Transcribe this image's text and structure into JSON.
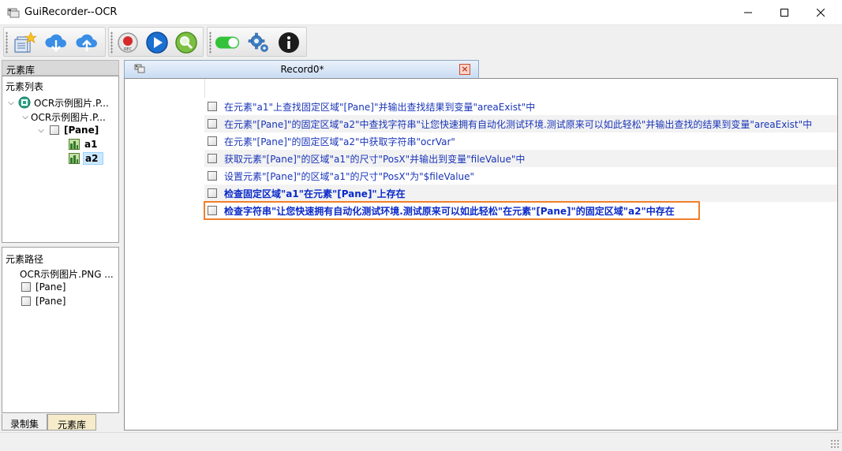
{
  "window": {
    "title": "GuiRecorder--OCR",
    "minimize_glyph": "—",
    "maximize_glyph": "☐",
    "close_glyph": "✕"
  },
  "toolbar": {
    "groups": [
      {
        "buttons": [
          "new-file-icon",
          "download-cloud-icon",
          "upload-cloud-icon"
        ]
      },
      {
        "buttons": [
          "record-icon",
          "play-icon",
          "search-icon"
        ]
      },
      {
        "buttons": [
          "toggle-on-icon",
          "settings-gear-icon",
          "info-icon"
        ]
      }
    ],
    "record_label": "REC"
  },
  "left_panel": {
    "library_header": "元素库",
    "tree_title": "元素列表",
    "tree": [
      {
        "label": "OCR示例图片.P...",
        "level": 0,
        "expanded": true,
        "icon": "target-icon"
      },
      {
        "label": "OCR示例图片.P...",
        "level": 1,
        "expanded": true,
        "icon": "none"
      },
      {
        "label": "[Pane]",
        "level": 2,
        "expanded": true,
        "icon": "checkbox-icon"
      },
      {
        "label": "a1",
        "level": 3,
        "icon": "image-element-icon"
      },
      {
        "label": "a2",
        "level": 3,
        "icon": "image-element-icon",
        "selected": true
      }
    ],
    "path_title": "元素路径",
    "path_items": [
      "OCR示例图片.PNG ...",
      "[Pane]",
      "[Pane]"
    ],
    "bottom_tabs": [
      "录制集",
      "元素库"
    ],
    "active_bottom_tab": "元素库"
  },
  "document": {
    "tab_title": "Record0*",
    "tab_close_glyph": "×",
    "steps": [
      {
        "text": "在元素\"a1\"上查找固定区域\"[Pane]\"并输出查找结果到变量\"areaExist\"中",
        "bold": false
      },
      {
        "text": "在元素\"[Pane]\"的固定区域\"a2\"中查找字符串\"让您快速拥有自动化测试环境.测试原来可以如此轻松\"并输出查找的结果到变量\"areaExist\"中",
        "bold": false
      },
      {
        "text": "在元素\"[Pane]\"的固定区域\"a2\"中获取字符串\"ocrVar\"",
        "bold": false
      },
      {
        "text": "获取元素\"[Pane]\"的区域\"a1\"的尺寸\"PosX\"并输出到变量\"fileValue\"中",
        "bold": false
      },
      {
        "text": "设置元素\"[Pane]\"的区域\"a1\"的尺寸\"PosX\"为\"$fileValue\"",
        "bold": false
      },
      {
        "text": "检查固定区域\"a1\"在元素\"[Pane]\"上存在",
        "bold": true
      },
      {
        "text": "检查字符串\"让您快速拥有自动化测试环境.测试原来可以如此轻松\"在元素\"[Pane]\"的固定区域\"a2\"中存在",
        "bold": true,
        "highlighted": true
      }
    ]
  },
  "colors": {
    "step_text": "#1a35b8",
    "highlight_border": "#f07f2a",
    "selection": "#cce8ff"
  }
}
